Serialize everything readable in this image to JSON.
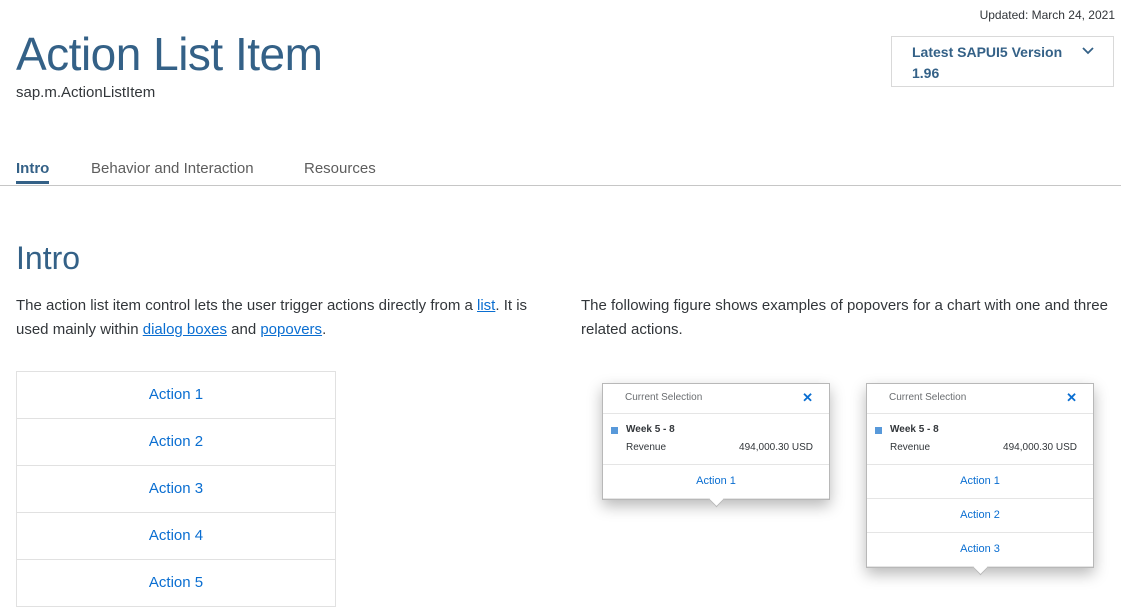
{
  "header": {
    "updated": "Updated: March 24, 2021",
    "title": "Action List Item",
    "subtitle": "sap.m.ActionListItem"
  },
  "version": {
    "label": "Latest SAPUI5 Version",
    "value": "1.96",
    "icon": "chevron-down-icon"
  },
  "tabs": [
    {
      "label": "Intro",
      "active": true
    },
    {
      "label": "Behavior and Interaction",
      "active": false
    },
    {
      "label": "Resources",
      "active": false
    }
  ],
  "intro": {
    "heading": "Intro",
    "left_text_1": "The action list item control lets the user trigger actions directly from a ",
    "link_list": "list",
    "left_text_2": ". It is used mainly within ",
    "link_dialog": "dialog boxes",
    "left_text_3": " and ",
    "link_popovers": "popovers",
    "left_text_4": ".",
    "right_text": "The following figure shows examples of popovers for a chart with one and three related actions."
  },
  "action_list": [
    "Action 1",
    "Action 2",
    "Action 3",
    "Action 4",
    "Action 5"
  ],
  "popovers": [
    {
      "title": "Current Selection",
      "close": "✕",
      "week": "Week 5 - 8",
      "revenue_label": "Revenue",
      "revenue_value": "494,000.30 USD",
      "actions": [
        "Action 1"
      ]
    },
    {
      "title": "Current Selection",
      "close": "✕",
      "week": "Week 5 - 8",
      "revenue_label": "Revenue",
      "revenue_value": "494,000.30 USD",
      "actions": [
        "Action 1",
        "Action 2",
        "Action 3"
      ]
    }
  ],
  "colors": {
    "title": "#346187",
    "link": "#0a6ed1",
    "legend": "#5899da"
  }
}
